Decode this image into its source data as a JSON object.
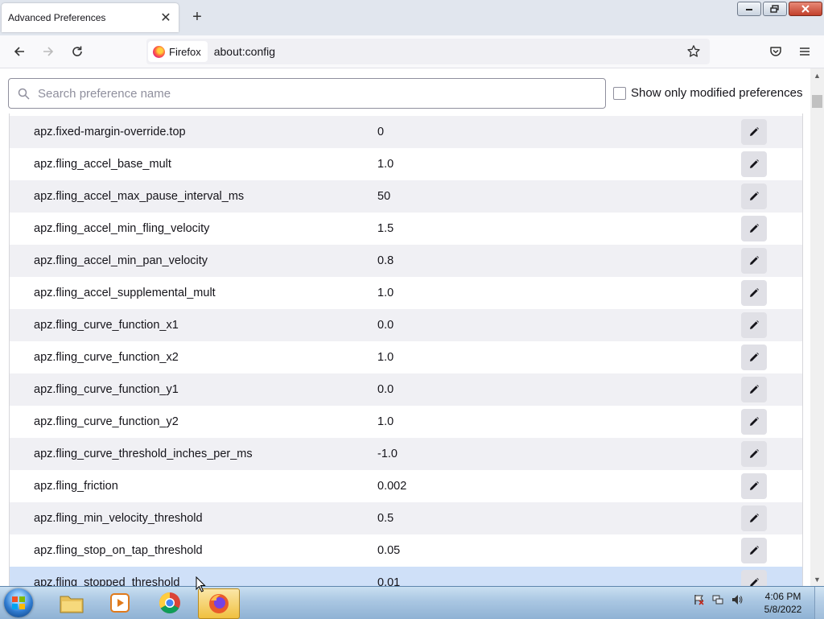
{
  "window": {
    "tab_title": "Advanced Preferences",
    "tab_close_symbol": "✕",
    "new_tab_symbol": "+"
  },
  "nav": {
    "identity_label": "Firefox",
    "url": "about:config"
  },
  "config": {
    "search_placeholder": "Search preference name",
    "modified_only_label": "Show only modified preferences",
    "prefs": [
      {
        "name": "apz.fixed-margin-override.top",
        "value": "0"
      },
      {
        "name": "apz.fling_accel_base_mult",
        "value": "1.0"
      },
      {
        "name": "apz.fling_accel_max_pause_interval_ms",
        "value": "50"
      },
      {
        "name": "apz.fling_accel_min_fling_velocity",
        "value": "1.5"
      },
      {
        "name": "apz.fling_accel_min_pan_velocity",
        "value": "0.8"
      },
      {
        "name": "apz.fling_accel_supplemental_mult",
        "value": "1.0"
      },
      {
        "name": "apz.fling_curve_function_x1",
        "value": "0.0"
      },
      {
        "name": "apz.fling_curve_function_x2",
        "value": "1.0"
      },
      {
        "name": "apz.fling_curve_function_y1",
        "value": "0.0"
      },
      {
        "name": "apz.fling_curve_function_y2",
        "value": "1.0"
      },
      {
        "name": "apz.fling_curve_threshold_inches_per_ms",
        "value": "-1.0"
      },
      {
        "name": "apz.fling_friction",
        "value": "0.002"
      },
      {
        "name": "apz.fling_min_velocity_threshold",
        "value": "0.5"
      },
      {
        "name": "apz.fling_stop_on_tap_threshold",
        "value": "0.05"
      },
      {
        "name": "apz.fling_stopped_threshold",
        "value": "0.01"
      }
    ],
    "selected_index": 14
  },
  "taskbar": {
    "clock_time": "4:06 PM",
    "clock_date": "5/8/2022"
  },
  "colors": {
    "row_alt": "#f0f0f4",
    "row_selected": "#cfe0f8",
    "accent": "#0060df"
  }
}
